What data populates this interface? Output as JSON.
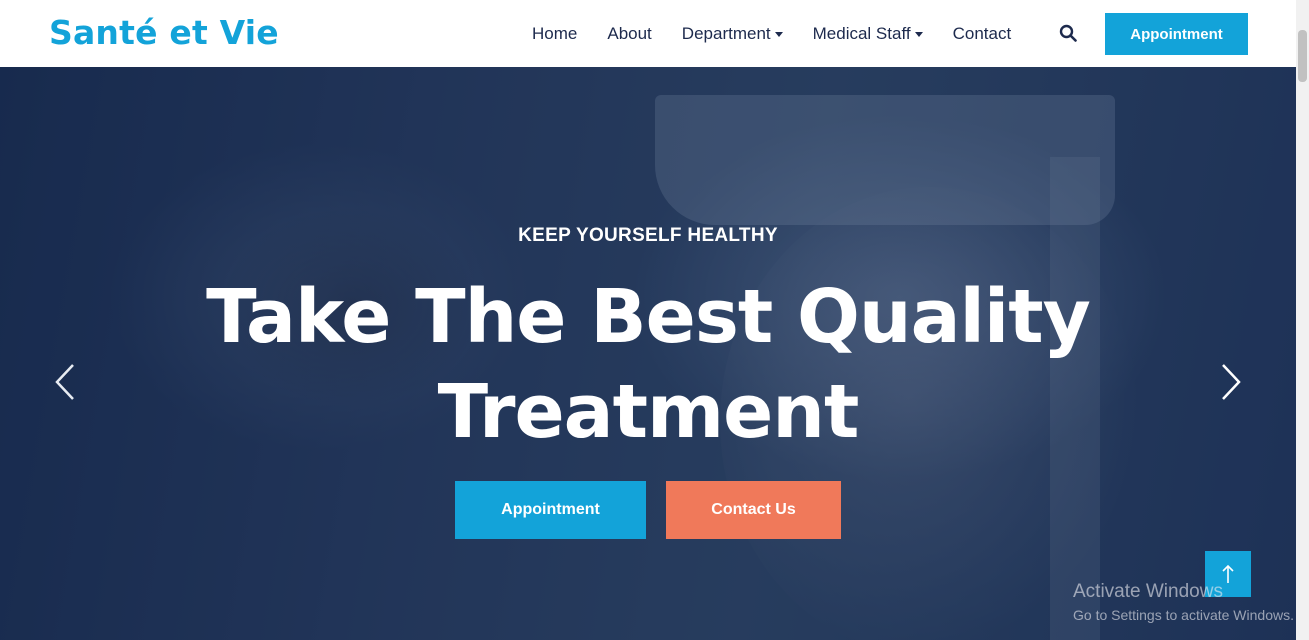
{
  "navbar": {
    "brand": "Santé et Vie",
    "links": [
      {
        "label": "Home"
      },
      {
        "label": "About"
      },
      {
        "label": "Department",
        "dropdown": true
      },
      {
        "label": "Medical Staff",
        "dropdown": true
      },
      {
        "label": "Contact"
      }
    ],
    "appointment_label": "Appointment"
  },
  "hero": {
    "subtitle": "KEEP YOURSELF HEALTHY",
    "title": "Take The Best Quality Treatment",
    "primary_button": "Appointment",
    "secondary_button": "Contact Us"
  },
  "watermark": {
    "title": "Activate Windows",
    "subtitle": "Go to Settings to activate Windows."
  },
  "colors": {
    "accent": "#13a3d9",
    "secondary": "#f0795a",
    "nav_text": "#1d2a4d"
  }
}
